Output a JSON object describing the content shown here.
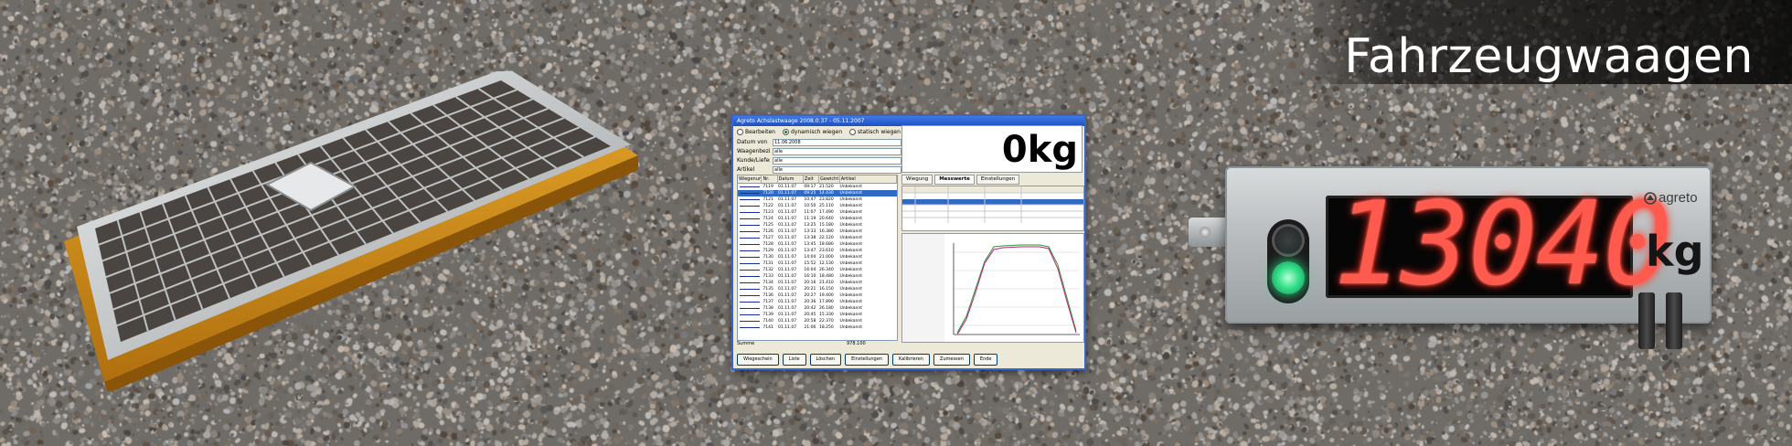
{
  "banner": {
    "headline": "Fahrzeugwaagen"
  },
  "software": {
    "window_title": "Agreto Achslastwaage 2008.0.37 - 05.11.2007",
    "modes": [
      "Bearbeiten",
      "dynamisch wiegen",
      "statisch wiegen"
    ],
    "filters": [
      {
        "label": "Datum von",
        "value": "11.06.2008"
      },
      {
        "label": "Waagenbezirk",
        "value": "alle"
      },
      {
        "label": "Kunde/Lieferant",
        "value": "alle"
      },
      {
        "label": "Artikel",
        "value": "alle"
      }
    ],
    "weight_value": "0",
    "weight_unit": "kg",
    "tabs": [
      "Wiegung",
      "Messwerte",
      "Einstellungen"
    ],
    "list_headers": [
      "Wiegenummer",
      "Nr.",
      "Datum",
      "Zeit",
      "Gewicht",
      "Artikel"
    ],
    "list_rows": [
      {
        "nr": "7119",
        "datum": "01.11.07",
        "zeit": "09:17",
        "gewicht": "21.520",
        "artikel": "Unbekannt"
      },
      {
        "nr": "7120",
        "datum": "01.11.07",
        "zeit": "09:25",
        "gewicht": "14.430",
        "artikel": "Unbekannt"
      },
      {
        "nr": "7121",
        "datum": "01.11.07",
        "zeit": "10:47",
        "gewicht": "23.820",
        "artikel": "Unbekannt"
      },
      {
        "nr": "7122",
        "datum": "01.11.07",
        "zeit": "10:50",
        "gewicht": "25.110",
        "artikel": "Unbekannt"
      },
      {
        "nr": "7123",
        "datum": "01.11.07",
        "zeit": "11:07",
        "gewicht": "17.490",
        "artikel": "Unbekannt"
      },
      {
        "nr": "7124",
        "datum": "01.11.07",
        "zeit": "11:19",
        "gewicht": "20.640",
        "artikel": "Unbekannt"
      },
      {
        "nr": "7125",
        "datum": "01.11.07",
        "zeit": "13:25",
        "gewicht": "15.180",
        "artikel": "Unbekannt"
      },
      {
        "nr": "7126",
        "datum": "01.11.07",
        "zeit": "13:33",
        "gewicht": "16.380",
        "artikel": "Unbekannt"
      },
      {
        "nr": "7127",
        "datum": "01.11.07",
        "zeit": "13:38",
        "gewicht": "22.120",
        "artikel": "Unbekannt"
      },
      {
        "nr": "7128",
        "datum": "01.11.07",
        "zeit": "13:45",
        "gewicht": "18.680",
        "artikel": "Unbekannt"
      },
      {
        "nr": "7129",
        "datum": "01.11.07",
        "zeit": "13:47",
        "gewicht": "23.610",
        "artikel": "Unbekannt"
      },
      {
        "nr": "7130",
        "datum": "01.11.07",
        "zeit": "14:04",
        "gewicht": "21.000",
        "artikel": "Unbekannt"
      },
      {
        "nr": "7131",
        "datum": "01.11.07",
        "zeit": "15:52",
        "gewicht": "12.130",
        "artikel": "Unbekannt"
      },
      {
        "nr": "7132",
        "datum": "01.11.07",
        "zeit": "16:04",
        "gewicht": "26.340",
        "artikel": "Unbekannt"
      },
      {
        "nr": "7133",
        "datum": "01.11.07",
        "zeit": "16:10",
        "gewicht": "18.480",
        "artikel": "Unbekannt"
      },
      {
        "nr": "7134",
        "datum": "01.11.07",
        "zeit": "20:16",
        "gewicht": "21.410",
        "artikel": "Unbekannt"
      },
      {
        "nr": "7135",
        "datum": "01.11.07",
        "zeit": "20:21",
        "gewicht": "16.150",
        "artikel": "Unbekannt"
      },
      {
        "nr": "7136",
        "datum": "01.11.07",
        "zeit": "20:27",
        "gewicht": "19.400",
        "artikel": "Unbekannt"
      },
      {
        "nr": "7137",
        "datum": "01.11.07",
        "zeit": "20:36",
        "gewicht": "17.890",
        "artikel": "Unbekannt"
      },
      {
        "nr": "7138",
        "datum": "01.11.07",
        "zeit": "20:42",
        "gewicht": "26.180",
        "artikel": "Unbekannt"
      },
      {
        "nr": "7139",
        "datum": "01.11.07",
        "zeit": "20:45",
        "gewicht": "15.330",
        "artikel": "Unbekannt"
      },
      {
        "nr": "7140",
        "datum": "01.11.07",
        "zeit": "20:58",
        "gewicht": "22.370",
        "artikel": "Unbekannt"
      },
      {
        "nr": "7141",
        "datum": "01.11.07",
        "zeit": "21:06",
        "gewicht": "18.250",
        "artikel": "Unbekannt"
      }
    ],
    "list_footer": [
      "Summe",
      "978.100"
    ],
    "buttons": [
      "Wiegeschein",
      "Liste",
      "Löschen",
      "Einstellungen",
      "Kalibrieren",
      "Zumessen",
      "Ende"
    ],
    "selected_row": 1
  },
  "display_unit": {
    "reading": "13040",
    "unit": "kg",
    "brand": "agreto",
    "led_color": "#ff4a3d",
    "light_on_color": "#35e08a"
  },
  "colors": {
    "gravel": "#6f6c68",
    "frame_wood": "#d99a1e",
    "frame_steel": "#c7cacc"
  }
}
